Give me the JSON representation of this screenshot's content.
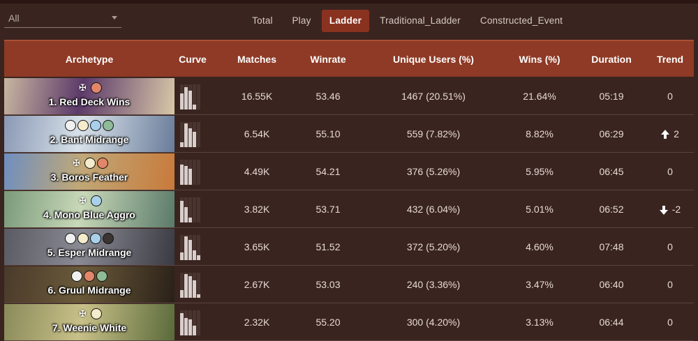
{
  "filter": {
    "value": "All"
  },
  "tabs": [
    {
      "label": "Total",
      "active": false
    },
    {
      "label": "Play",
      "active": false
    },
    {
      "label": "Ladder",
      "active": true
    },
    {
      "label": "Traditional_Ladder",
      "active": false
    },
    {
      "label": "Constructed_Event",
      "active": false
    }
  ],
  "columns": [
    "Archetype",
    "Curve",
    "Matches",
    "Winrate",
    "Unique Users (%)",
    "Wins (%)",
    "Duration",
    "Trend"
  ],
  "rows": [
    {
      "name": "1. Red Deck Wins",
      "colors": [
        "R"
      ],
      "guild": true,
      "curve": [
        0.65,
        0.9,
        0.75,
        0.2,
        0.0
      ],
      "matches": "16.55K",
      "winrate": "53.46",
      "users": "1467 (20.51%)",
      "wins": "21.64%",
      "duration": "05:19",
      "trend": "0",
      "trend_dir": "none",
      "bg1": "#c9b6a0",
      "bg2": "#5c3a6a",
      "bg3": "#d9c8a8"
    },
    {
      "name": "2. Bant Midrange",
      "colors": [
        "C",
        "W",
        "U",
        "G"
      ],
      "guild": false,
      "curve": [
        0.2,
        0.95,
        0.75,
        0.6,
        0.0
      ],
      "matches": "6.54K",
      "winrate": "55.10",
      "users": "559 (7.82%)",
      "wins": "8.82%",
      "duration": "06:29",
      "trend": "2",
      "trend_dir": "up",
      "bg1": "#8a98b4",
      "bg2": "#d8e2ea",
      "bg3": "#6a7c9a"
    },
    {
      "name": "3. Boros Feather",
      "colors": [
        "W",
        "R"
      ],
      "guild": true,
      "curve": [
        0.8,
        0.75,
        0.65,
        0.0,
        0.0
      ],
      "matches": "4.49K",
      "winrate": "54.21",
      "users": "376 (5.26%)",
      "wins": "5.95%",
      "duration": "06:45",
      "trend": "0",
      "trend_dir": "none",
      "bg1": "#6e8ec0",
      "bg2": "#c0a878",
      "bg3": "#c87a3a"
    },
    {
      "name": "4. Mono Blue Aggro",
      "colors": [
        "U"
      ],
      "guild": true,
      "curve": [
        0.85,
        0.6,
        0.2,
        0.0,
        0.0
      ],
      "matches": "3.82K",
      "winrate": "53.71",
      "users": "432 (6.04%)",
      "wins": "5.01%",
      "duration": "06:52",
      "trend": "-2",
      "trend_dir": "down",
      "bg1": "#7a9a7a",
      "bg2": "#c8d8b8",
      "bg3": "#5a7a6a"
    },
    {
      "name": "5. Esper Midrange",
      "colors": [
        "C",
        "W",
        "U",
        "B"
      ],
      "guild": false,
      "curve": [
        0.3,
        0.95,
        0.8,
        0.4,
        0.2
      ],
      "matches": "3.65K",
      "winrate": "51.52",
      "users": "372 (5.20%)",
      "wins": "4.60%",
      "duration": "07:48",
      "trend": "0",
      "trend_dir": "none",
      "bg1": "#5a5a62",
      "bg2": "#8a8a94",
      "bg3": "#3a3a42"
    },
    {
      "name": "6. Gruul Midrange",
      "colors": [
        "C",
        "R",
        "G"
      ],
      "guild": false,
      "curve": [
        0.3,
        0.95,
        0.85,
        0.7,
        0.15
      ],
      "matches": "2.67K",
      "winrate": "53.03",
      "users": "240 (3.36%)",
      "wins": "3.47%",
      "duration": "06:40",
      "trend": "0",
      "trend_dir": "none",
      "bg1": "#4a3a2a",
      "bg2": "#6a5a3a",
      "bg3": "#2a2018"
    },
    {
      "name": "7. Weenie White",
      "colors": [
        "W"
      ],
      "guild": true,
      "curve": [
        0.9,
        0.7,
        0.65,
        0.4,
        0.0
      ],
      "matches": "2.32K",
      "winrate": "55.20",
      "users": "300 (4.20%)",
      "wins": "3.13%",
      "duration": "06:44",
      "trend": "0",
      "trend_dir": "none",
      "bg1": "#8a8a5a",
      "bg2": "#c8c088",
      "bg3": "#5a6a3a"
    }
  ],
  "colors": {
    "header": "#8e3a26",
    "active_tab": "#8a3220",
    "background": "#3a2420"
  }
}
